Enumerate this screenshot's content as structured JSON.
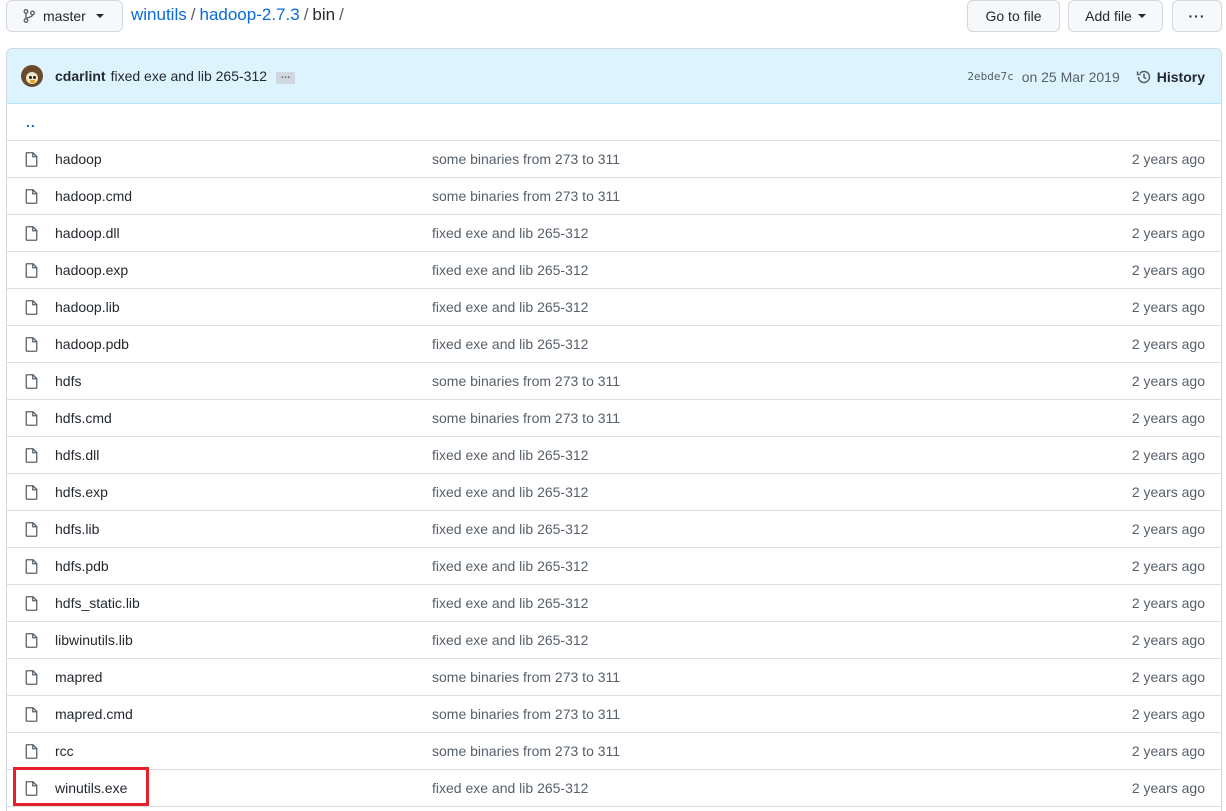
{
  "toolbar": {
    "branch_label": "master",
    "goto_file_label": "Go to file",
    "add_file_label": "Add file",
    "more_label": "···"
  },
  "breadcrumb": {
    "repo": "winutils",
    "folder": "hadoop-2.7.3",
    "current": "bin",
    "separator": "/"
  },
  "commit": {
    "author": "cdarlint",
    "message": "fixed exe and lib 265-312",
    "ellipsis": "…",
    "sha": "2ebde7c",
    "date": "on 25 Mar 2019",
    "history_label": "History"
  },
  "parent_dir_label": "..",
  "files": [
    {
      "name": "hadoop",
      "commit": "some binaries from 273 to 311",
      "age": "2 years ago"
    },
    {
      "name": "hadoop.cmd",
      "commit": "some binaries from 273 to 311",
      "age": "2 years ago"
    },
    {
      "name": "hadoop.dll",
      "commit": "fixed exe and lib 265-312",
      "age": "2 years ago"
    },
    {
      "name": "hadoop.exp",
      "commit": "fixed exe and lib 265-312",
      "age": "2 years ago"
    },
    {
      "name": "hadoop.lib",
      "commit": "fixed exe and lib 265-312",
      "age": "2 years ago"
    },
    {
      "name": "hadoop.pdb",
      "commit": "fixed exe and lib 265-312",
      "age": "2 years ago"
    },
    {
      "name": "hdfs",
      "commit": "some binaries from 273 to 311",
      "age": "2 years ago"
    },
    {
      "name": "hdfs.cmd",
      "commit": "some binaries from 273 to 311",
      "age": "2 years ago"
    },
    {
      "name": "hdfs.dll",
      "commit": "fixed exe and lib 265-312",
      "age": "2 years ago"
    },
    {
      "name": "hdfs.exp",
      "commit": "fixed exe and lib 265-312",
      "age": "2 years ago"
    },
    {
      "name": "hdfs.lib",
      "commit": "fixed exe and lib 265-312",
      "age": "2 years ago"
    },
    {
      "name": "hdfs.pdb",
      "commit": "fixed exe and lib 265-312",
      "age": "2 years ago"
    },
    {
      "name": "hdfs_static.lib",
      "commit": "fixed exe and lib 265-312",
      "age": "2 years ago"
    },
    {
      "name": "libwinutils.lib",
      "commit": "fixed exe and lib 265-312",
      "age": "2 years ago"
    },
    {
      "name": "mapred",
      "commit": "some binaries from 273 to 311",
      "age": "2 years ago"
    },
    {
      "name": "mapred.cmd",
      "commit": "some binaries from 273 to 311",
      "age": "2 years ago"
    },
    {
      "name": "rcc",
      "commit": "some binaries from 273 to 311",
      "age": "2 years ago"
    },
    {
      "name": "winutils.exe",
      "commit": "fixed exe and lib 265-312",
      "age": "2 years ago"
    }
  ],
  "colors": {
    "link": "#0969da",
    "commit_header_bg": "#ddf4ff",
    "highlight_box": "#e5212b"
  },
  "highlighted_file": "winutils.exe"
}
